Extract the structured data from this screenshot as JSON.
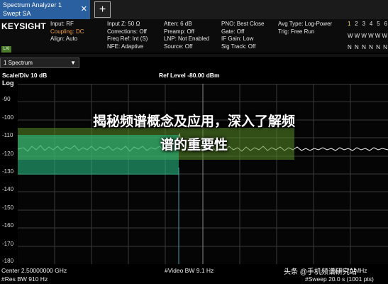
{
  "tab": {
    "line1": "Spectrum Analyzer 1",
    "line2": "Swept SA",
    "close": "✕"
  },
  "add_label": "+",
  "brand": {
    "logo": "KEYSIGHT",
    "sub": "LXI"
  },
  "info": {
    "col1": [
      "Input: RF",
      "Coupling: DC",
      "Align: Auto"
    ],
    "col2": [
      "Input Z: 50 Ω",
      "Corrections: Off",
      "Freq Ref: Int (S)",
      "NFE: Adaptive"
    ],
    "col3": [
      "Atten: 6 dB",
      "Preamp: Off",
      "LNP: Not Enabled",
      "Source: Off"
    ],
    "col4": [
      "PNO: Best Close",
      "Gate: Off",
      "IF Gain: Low",
      "Sig Track: Off"
    ],
    "col5": [
      "Avg Type: Log-Power",
      "Trig: Free Run"
    ],
    "trace_nums": [
      "1",
      "2",
      "3",
      "4",
      "5",
      "6"
    ],
    "trace_row2": [
      "W",
      "W",
      "W",
      "W",
      "W",
      "W"
    ],
    "trace_row3": [
      "N",
      "N",
      "N",
      "N",
      "N",
      "N"
    ]
  },
  "dropdown_label": "1 Spectrum",
  "scale": "Scale/Div 10 dB",
  "scale_type": "Log",
  "ref_level": "Ref Level -80.00 dBm",
  "y_ticks": [
    "-90",
    "-100",
    "-110",
    "-120",
    "-130",
    "-140",
    "-150",
    "-160",
    "-170",
    "-180"
  ],
  "bottom": {
    "center": "Center 2.50000000 GHz",
    "res_bw": "#Res BW 910 Hz",
    "video_bw": "#Video BW 9.1 Hz",
    "span": "Span 10 MHz",
    "sweep": "#Sweep 20.0 s (1001 pts)"
  },
  "overlay": {
    "title_line1": "揭秘频谱概念及应用，深入了解频",
    "title_line2": "谱的重要性"
  },
  "watermark": "头条 @手机频谱研究站",
  "colors": {
    "tab": "#2a5fa0",
    "trace": "#f0f0f0",
    "band_green": "#5a8c28",
    "band_teal": "#28c88c"
  }
}
